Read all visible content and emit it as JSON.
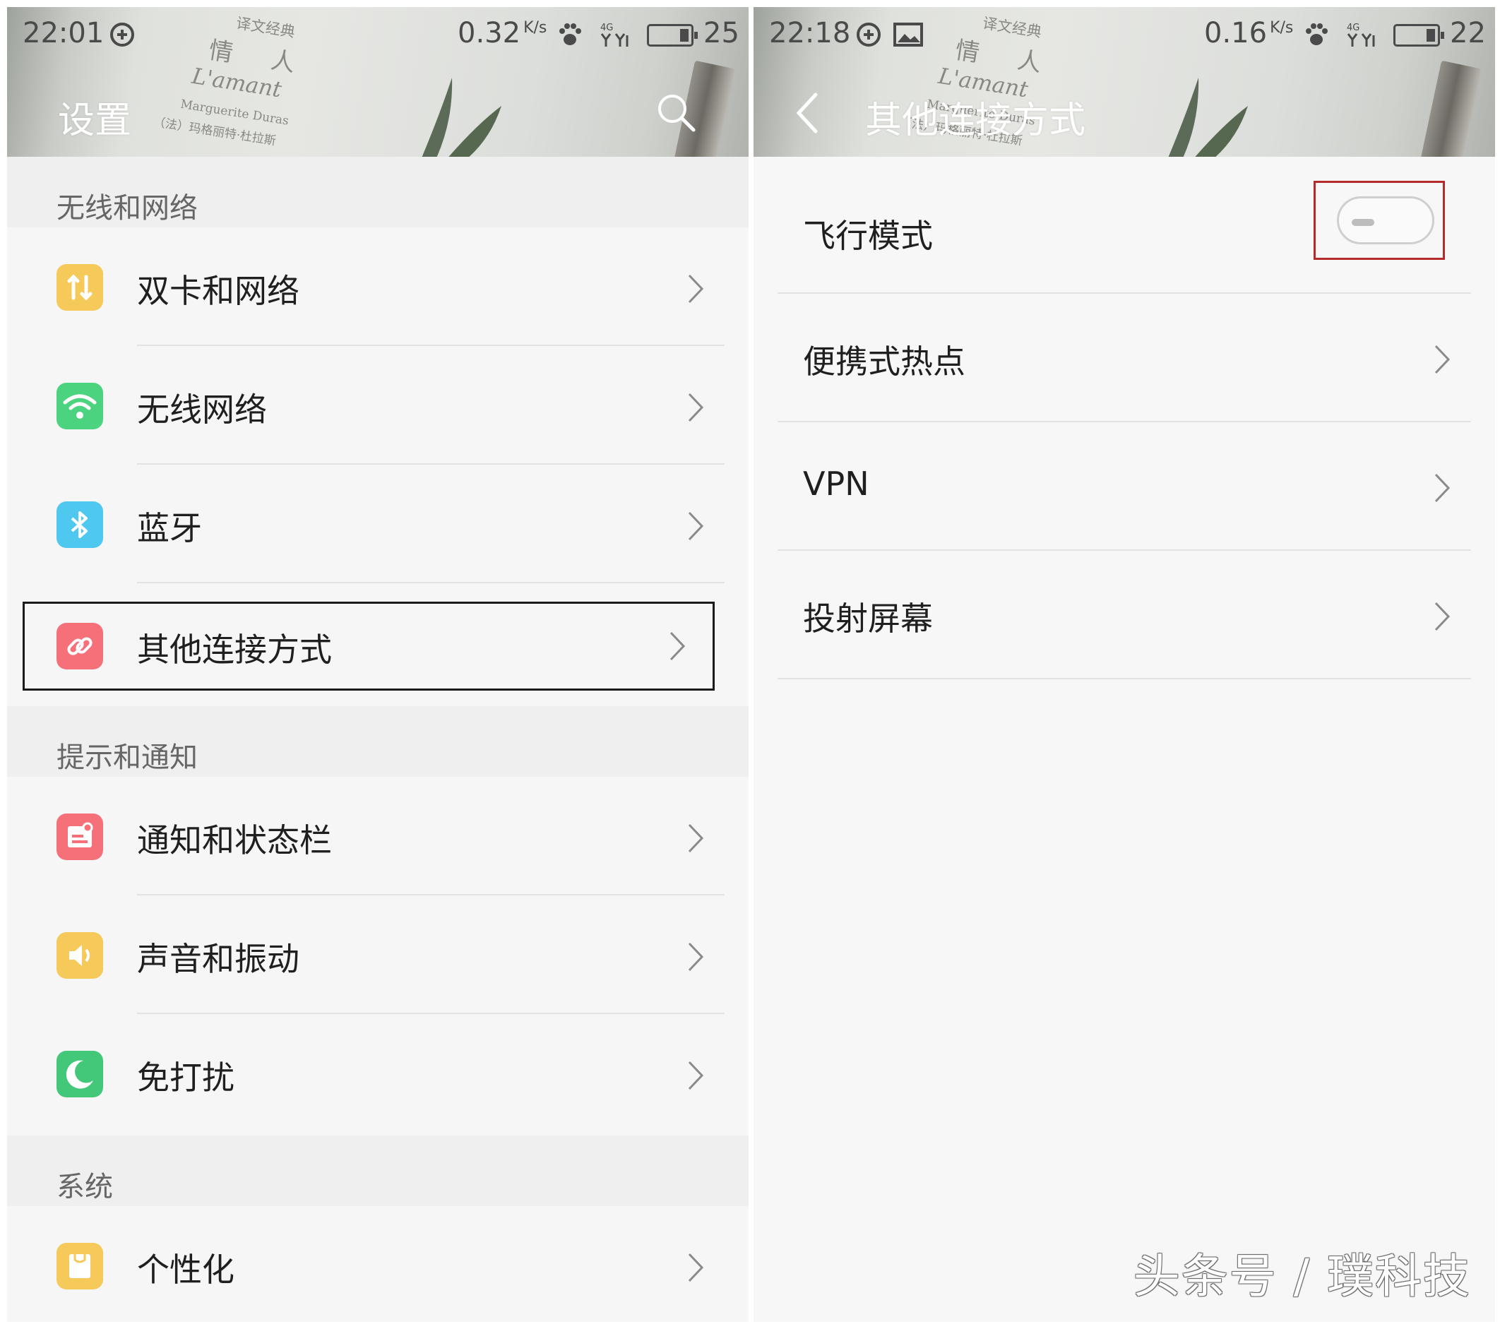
{
  "colors": {
    "highlight_left": "#1a1a1a",
    "highlight_right": "#b52a2a",
    "icon_dual_sim": "#f5c95a",
    "icon_wifi": "#4cd37f",
    "icon_bluetooth": "#4fc8ef",
    "icon_other_conn": "#f6707a",
    "icon_notify": "#f6707a",
    "icon_sound": "#f5c95a",
    "icon_dnd": "#43c879",
    "icon_personal": "#f5c95a"
  },
  "left": {
    "status": {
      "time": "22:01",
      "speed": "0.32",
      "speed_unit": "K/s",
      "battery": "25",
      "icons": [
        "sync-icon",
        "paw-icon",
        "signal-4g-icon",
        "battery-icon"
      ]
    },
    "title": "设置",
    "search_icon": "search-icon",
    "sections": [
      {
        "header": "无线和网络",
        "items": [
          {
            "label": "双卡和网络",
            "icon": "dual-sim-icon"
          },
          {
            "label": "无线网络",
            "icon": "wifi-icon"
          },
          {
            "label": "蓝牙",
            "icon": "bluetooth-icon"
          },
          {
            "label": "其他连接方式",
            "icon": "link-icon",
            "highlighted": true
          }
        ]
      },
      {
        "header": "提示和通知",
        "items": [
          {
            "label": "通知和状态栏",
            "icon": "notification-icon"
          },
          {
            "label": "声音和振动",
            "icon": "speaker-icon"
          },
          {
            "label": "免打扰",
            "icon": "moon-icon"
          }
        ]
      },
      {
        "header": "系统",
        "items": [
          {
            "label": "个性化",
            "icon": "personalize-icon"
          }
        ]
      }
    ]
  },
  "right": {
    "status": {
      "time": "22:18",
      "speed": "0.16",
      "speed_unit": "K/s",
      "battery": "22",
      "icons": [
        "sync-icon",
        "image-icon",
        "paw-icon",
        "signal-4g-icon",
        "battery-icon"
      ]
    },
    "title": "其他连接方式",
    "back_icon": "back-arrow-icon",
    "items": [
      {
        "label": "飞行模式",
        "toggle": "off",
        "highlighted": true
      },
      {
        "label": "便携式热点"
      },
      {
        "label": "VPN"
      },
      {
        "label": "投射屏幕"
      }
    ]
  },
  "watermark": "头条号 / 璞科技"
}
